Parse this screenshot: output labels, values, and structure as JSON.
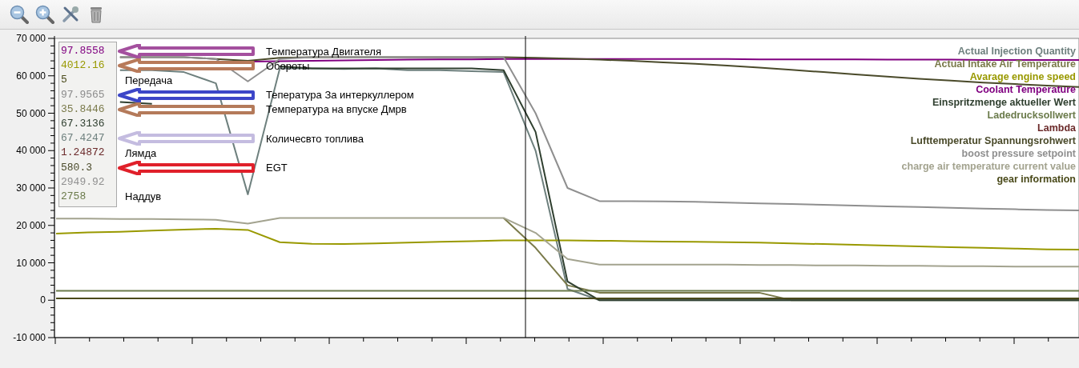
{
  "toolbar": {
    "buttons": [
      {
        "kind": "zoom-out"
      },
      {
        "kind": "zoom-in"
      },
      {
        "kind": "tools"
      },
      {
        "kind": "delete"
      }
    ]
  },
  "chart": {
    "chart_data": {
      "type": "line",
      "ylim": [
        -10000,
        70000
      ],
      "yticks": [
        {
          "value": 70000,
          "label": "70 000"
        },
        {
          "value": 60000,
          "label": "60 000"
        },
        {
          "value": 50000,
          "label": "50 000"
        },
        {
          "value": 40000,
          "label": "40 000"
        },
        {
          "value": 30000,
          "label": "30 000"
        },
        {
          "value": 20000,
          "label": "20 000"
        },
        {
          "value": 10000,
          "label": "10 000"
        },
        {
          "value": 0,
          "label": "0"
        },
        {
          "value": -10000,
          "label": "-10 000"
        }
      ],
      "categories": [
        null,
        null,
        null,
        null,
        null,
        null,
        null,
        null,
        null,
        null,
        null,
        null,
        null,
        null,
        null,
        null,
        null,
        null,
        null,
        null,
        null,
        null,
        null,
        null,
        null,
        null,
        null,
        null,
        null,
        null,
        null,
        null,
        null
      ],
      "series": [
        {
          "name": "Actual Injection Quantity",
          "color": "#6e807e",
          "values": [
            null,
            null,
            61500,
            61500,
            61000,
            58000,
            28300,
            62000,
            62000,
            61800,
            62000,
            61500,
            61500,
            61200,
            61000,
            40000,
            3000,
            0,
            0,
            0,
            0,
            0,
            0,
            0,
            0,
            0,
            0,
            0,
            0,
            0,
            0,
            0,
            0
          ]
        },
        {
          "name": "Actual Intake Air Temperature",
          "color": "#7a7a4a",
          "values": [
            null,
            null,
            null,
            null,
            null,
            null,
            null,
            null,
            null,
            null,
            null,
            null,
            null,
            null,
            22000,
            14000,
            4000,
            2000,
            2000,
            2000,
            2000,
            2000,
            2000,
            0,
            0,
            0,
            0,
            0,
            0,
            0,
            0,
            0,
            0
          ]
        },
        {
          "name": "Avarage engine speed",
          "color": "#999900",
          "values": [
            17800,
            18100,
            18300,
            18600,
            18900,
            19100,
            18800,
            15500,
            15100,
            15000,
            15200,
            15400,
            15600,
            15800,
            16000,
            16000,
            16000,
            15900,
            15800,
            15700,
            15600,
            15500,
            15400,
            15200,
            15000,
            14800,
            14600,
            14400,
            14200,
            14000,
            13800,
            13600,
            13500
          ]
        },
        {
          "name": "Coolant Temperature",
          "color": "#800080",
          "values": [
            null,
            null,
            null,
            null,
            null,
            null,
            63800,
            63900,
            64000,
            64100,
            64200,
            64300,
            64400,
            64400,
            64500,
            64500,
            64500,
            64500,
            64500,
            64500,
            64500,
            64500,
            64400,
            64400,
            64400,
            64400,
            64300,
            64300,
            64300,
            64200,
            64200,
            64200,
            64200
          ]
        },
        {
          "name": "Einspritzmenge aktueller Wert",
          "color": "#2f3f2f",
          "values": [
            null,
            null,
            53000,
            52500,
            null,
            null,
            null,
            62500,
            62000,
            62000,
            62000,
            62000,
            62000,
            62000,
            61500,
            45000,
            5000,
            0,
            0,
            0,
            0,
            0,
            0,
            0,
            0,
            0,
            0,
            0,
            0,
            0,
            0,
            0,
            0
          ]
        },
        {
          "name": "Ladedrucksollwert",
          "color": "#6b7b4b",
          "values": [
            2500,
            2500,
            2500,
            2500,
            2500,
            2500,
            2500,
            2500,
            2500,
            2500,
            2500,
            2500,
            2500,
            2500,
            2500,
            2500,
            2500,
            2500,
            2500,
            2500,
            2500,
            2500,
            2500,
            2500,
            2500,
            2500,
            2500,
            2500,
            2500,
            2500,
            2500,
            2500,
            2500
          ]
        },
        {
          "name": "Lambda",
          "color": "#6b2a2a",
          "values": [
            null,
            null,
            null,
            null,
            null,
            null,
            null,
            null,
            null,
            null,
            null,
            null,
            null,
            null,
            null,
            null,
            null,
            null,
            null,
            null,
            null,
            null,
            null,
            null,
            null,
            null,
            null,
            null,
            null,
            null,
            null,
            null,
            null
          ]
        },
        {
          "name": "Lufttemperatur Spannungsrohwert",
          "color": "#4a4a2a",
          "values": [
            null,
            null,
            65000,
            65000,
            65000,
            64500,
            64000,
            64800,
            65000,
            65000,
            65000,
            65000,
            65000,
            65000,
            65000,
            64800,
            64600,
            64300,
            64000,
            63600,
            63200,
            62700,
            62200,
            61600,
            61000,
            60400,
            59800,
            59200,
            58700,
            58200,
            57800,
            57400,
            57000
          ]
        },
        {
          "name": "boost pressure setpoint",
          "color": "#8f8f8f",
          "values": [
            null,
            null,
            65000,
            65000,
            65000,
            64500,
            58500,
            64500,
            65000,
            65000,
            65000,
            65000,
            65000,
            65000,
            65000,
            50000,
            30000,
            26500,
            26500,
            26400,
            26300,
            26100,
            25900,
            25700,
            25500,
            25300,
            25100,
            24900,
            24700,
            24500,
            24300,
            24100,
            24000
          ]
        },
        {
          "name": "charge air temperature current value",
          "color": "#a3a38f",
          "values": [
            21800,
            21800,
            21700,
            21700,
            21600,
            21500,
            20500,
            22000,
            22000,
            22000,
            22000,
            22000,
            22000,
            22000,
            22000,
            18000,
            11000,
            9500,
            9500,
            9500,
            9500,
            9500,
            9400,
            9400,
            9300,
            9300,
            9200,
            9200,
            9100,
            9100,
            9000,
            9000,
            9000
          ]
        },
        {
          "name": "gear information",
          "color": "#4a4a1a",
          "values": [
            500,
            500,
            500,
            500,
            500,
            500,
            500,
            500,
            500,
            500,
            500,
            500,
            500,
            500,
            500,
            500,
            500,
            500,
            500,
            500,
            500,
            500,
            500,
            500,
            500,
            500,
            500,
            500,
            500,
            500,
            500,
            500,
            500
          ]
        }
      ]
    }
  },
  "readout": [
    {
      "value": "97.8558",
      "color": "#800080",
      "note": {
        "label": "Температура Двигателя",
        "color": "#a4509e"
      }
    },
    {
      "value": "4012.16",
      "color": "#999900",
      "note": {
        "label": "Обороты",
        "color": "#b87a5a"
      }
    },
    {
      "value": "5",
      "color": "#4a4a1a",
      "note": {
        "label": "Передача"
      }
    },
    {
      "value": "97.9565",
      "color": "#8c8c8c",
      "note": {
        "label": "Тепература За интеркуллером",
        "color": "#3c46c8"
      }
    },
    {
      "value": "35.8446",
      "color": "#7a7a4a",
      "note": {
        "label": "Температура на впуске Дмрв",
        "color": "#b47a5a"
      }
    },
    {
      "value": "67.3136",
      "color": "#2f3f2f"
    },
    {
      "value": "67.4247",
      "color": "#6e807e",
      "note": {
        "label": "Количесвто топлива",
        "color": "#c4bce0"
      }
    },
    {
      "value": "1.24872",
      "color": "#6b2a2a",
      "note": {
        "label": "Лямда"
      }
    },
    {
      "value": "580.3",
      "color": "#4a4a2a",
      "note": {
        "label": "EGT",
        "color": "#e0202a"
      }
    },
    {
      "value": "2949.92",
      "color": "#909090"
    },
    {
      "value": "2758",
      "color": "#6b7b4b",
      "note": {
        "label": "Наддув"
      }
    }
  ]
}
